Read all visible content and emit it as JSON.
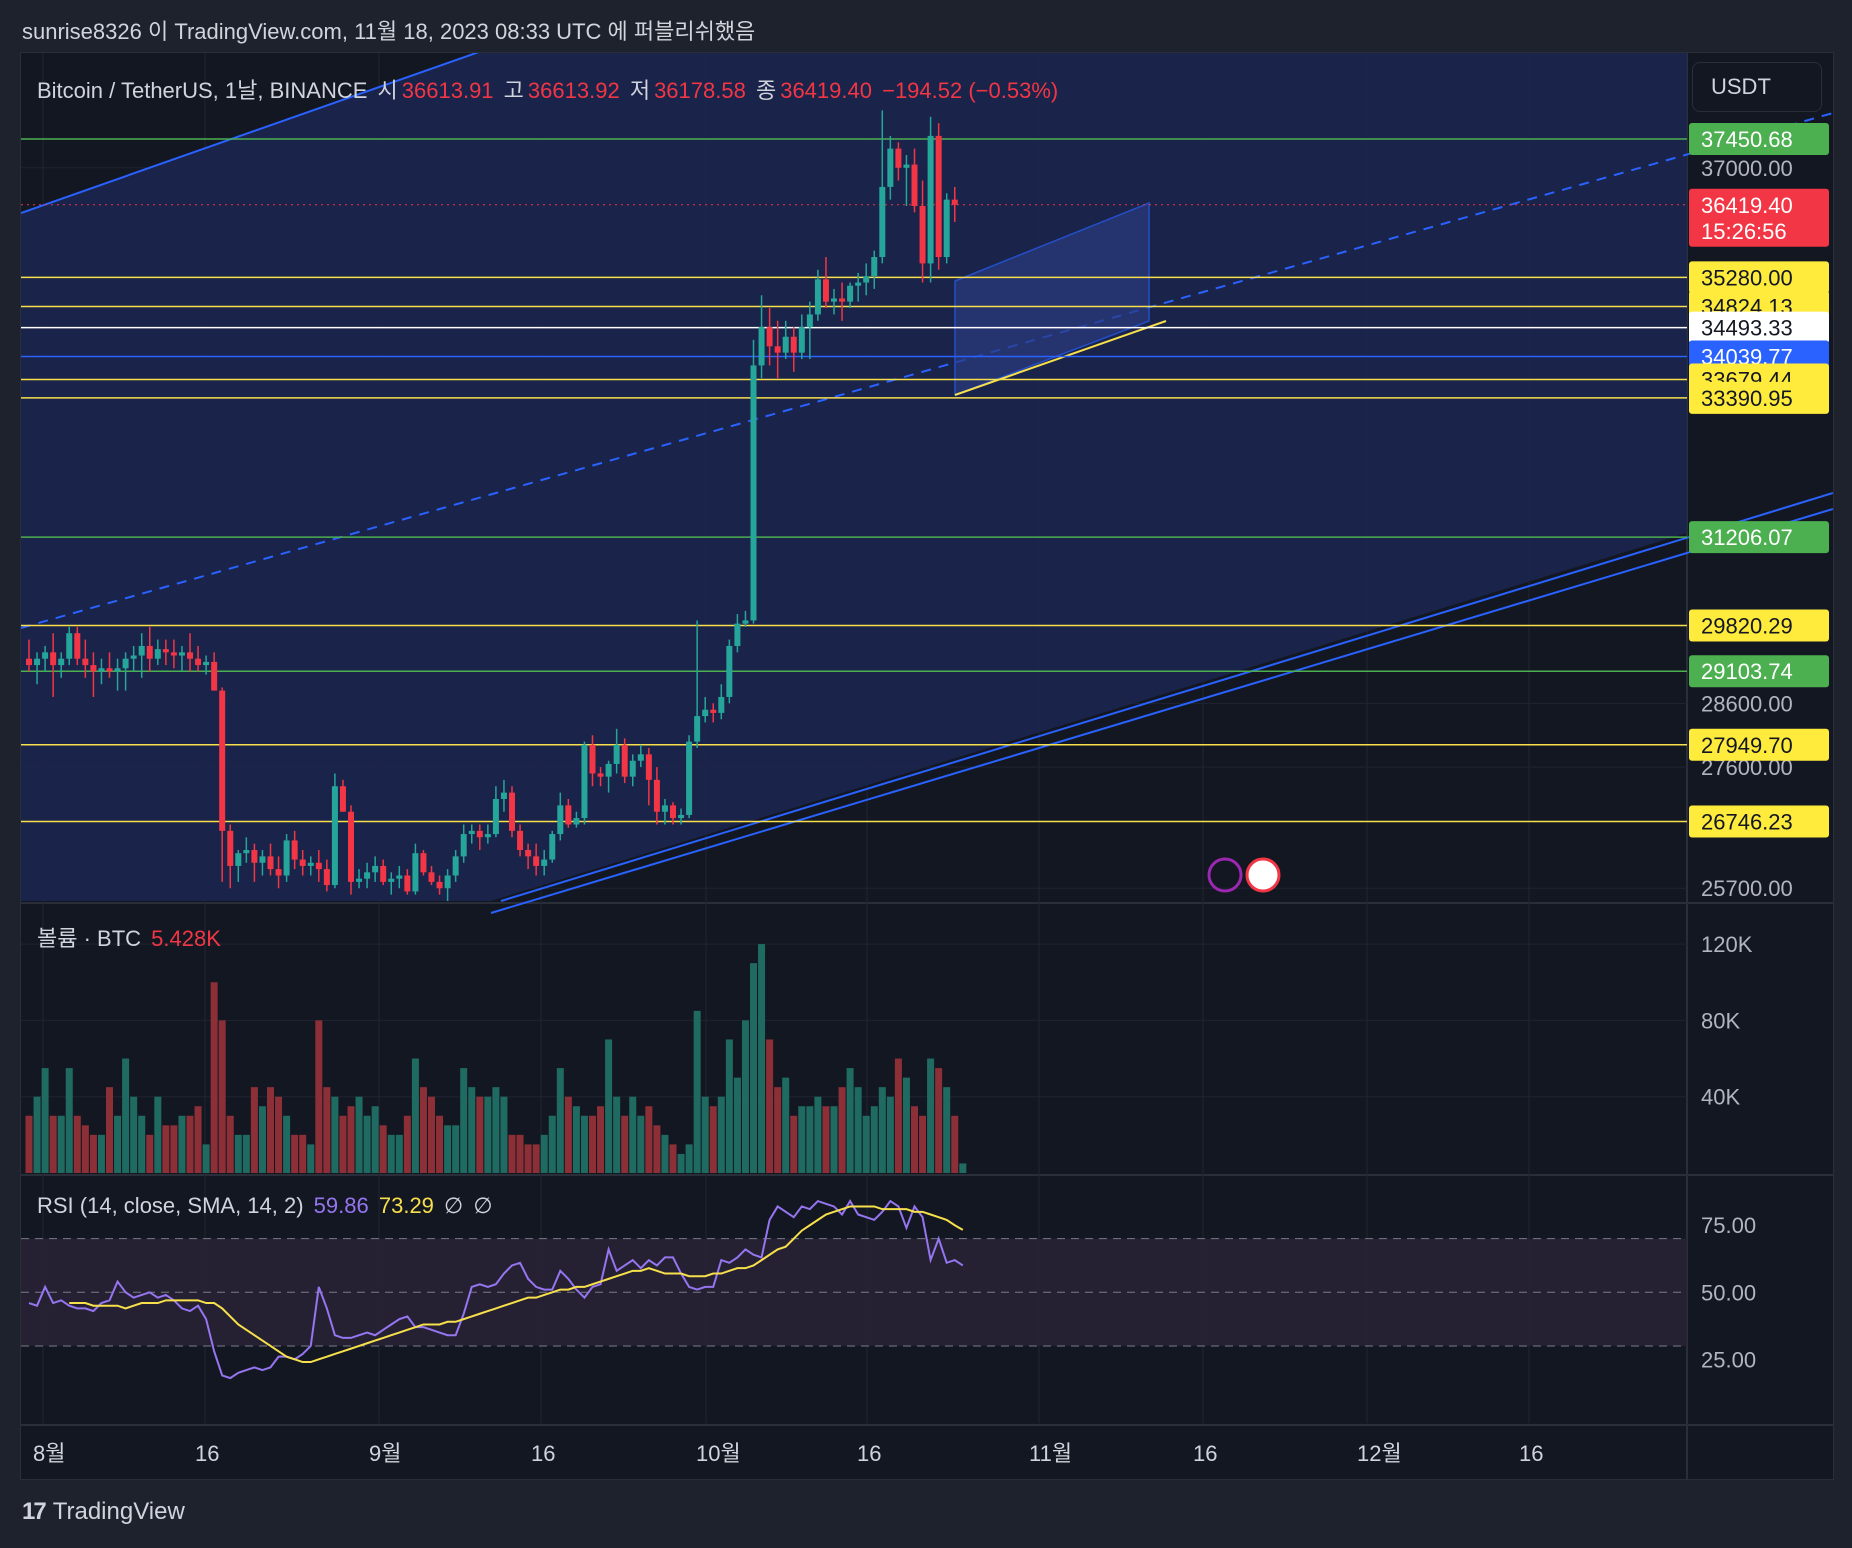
{
  "header": {
    "publisher_line": "sunrise8326 이 TradingView.com, 11월 18, 2023 08:33 UTC 에 퍼블리쉬했음"
  },
  "legend": {
    "symbol": "Bitcoin / TetherUS, 1날, BINANCE",
    "open_label": "시",
    "open_value": "36613.91",
    "high_label": "고",
    "high_value": "36613.92",
    "low_label": "저",
    "low_value": "36178.58",
    "close_label": "종",
    "close_value": "36419.40",
    "change": "−194.52 (−0.53%)"
  },
  "currency": "USDT",
  "volume_legend": {
    "label": "볼륨 · BTC",
    "value": "5.428K"
  },
  "rsi_legend": {
    "label": "RSI (14, close, SMA, 14, 2)",
    "rsi_value": "59.86",
    "sma_value": "73.29",
    "na1": "∅",
    "na2": "∅"
  },
  "footer": {
    "brand": "TradingView",
    "logo": "17"
  },
  "colors": {
    "up": "#26a69a",
    "down": "#f23645",
    "ma_yellow": "#f7e04b",
    "rsi_purple": "#9575f0",
    "green_level": "#4caf50",
    "blue_level": "#2962ff"
  },
  "chart_data": {
    "type": "candlestick",
    "price_axis": {
      "ticks": [
        "37000.00",
        "28600.00",
        "27600.00",
        "25700.00"
      ],
      "ylim": [
        25500,
        38800
      ]
    },
    "time_axis": {
      "labels": [
        "8월",
        "16",
        "9월",
        "16",
        "10월",
        "16",
        "11월",
        "16",
        "12월",
        "16"
      ]
    },
    "price_levels": [
      {
        "value": "37450.68",
        "kind": "green"
      },
      {
        "value": "36419.40",
        "kind": "current",
        "countdown": "15:26:56"
      },
      {
        "value": "35280.00",
        "kind": "yellow"
      },
      {
        "value": "34824.13",
        "kind": "yellow"
      },
      {
        "value": "34493.33",
        "kind": "white"
      },
      {
        "value": "34039.77",
        "kind": "blue"
      },
      {
        "value": "33679.44",
        "kind": "yellow"
      },
      {
        "value": "33390.95",
        "kind": "yellow"
      },
      {
        "value": "31206.07",
        "kind": "green"
      },
      {
        "value": "29820.29",
        "kind": "yellow"
      },
      {
        "value": "29103.74",
        "kind": "green"
      },
      {
        "value": "27949.70",
        "kind": "yellow"
      },
      {
        "value": "26746.23",
        "kind": "yellow"
      }
    ],
    "candles_ohlc": [
      [
        29300,
        29600,
        29100,
        29200
      ],
      [
        29200,
        29400,
        28900,
        29300
      ],
      [
        29300,
        29500,
        29100,
        29400
      ],
      [
        29400,
        29700,
        28700,
        29200
      ],
      [
        29200,
        29400,
        29000,
        29300
      ],
      [
        29300,
        29800,
        29200,
        29700
      ],
      [
        29700,
        29800,
        29200,
        29300
      ],
      [
        29300,
        29600,
        29000,
        29200
      ],
      [
        29200,
        29400,
        28700,
        29100
      ],
      [
        29100,
        29300,
        28900,
        29150
      ],
      [
        29150,
        29400,
        29000,
        29100
      ],
      [
        29100,
        29300,
        28800,
        29150
      ],
      [
        29150,
        29400,
        28800,
        29300
      ],
      [
        29300,
        29500,
        29100,
        29350
      ],
      [
        29350,
        29700,
        29000,
        29500
      ],
      [
        29500,
        29800,
        29100,
        29300
      ],
      [
        29300,
        29600,
        29200,
        29450
      ],
      [
        29450,
        29600,
        29200,
        29400
      ],
      [
        29400,
        29600,
        29150,
        29350
      ],
      [
        29350,
        29500,
        29100,
        29400
      ],
      [
        29400,
        29700,
        29100,
        29300
      ],
      [
        29300,
        29500,
        29100,
        29200
      ],
      [
        29200,
        29350,
        29050,
        29250
      ],
      [
        29250,
        29400,
        28800,
        28800
      ],
      [
        28800,
        28850,
        25800,
        26600
      ],
      [
        26600,
        26700,
        25700,
        26050
      ],
      [
        26050,
        26300,
        25800,
        26250
      ],
      [
        26250,
        26500,
        26100,
        26300
      ],
      [
        26300,
        26400,
        25800,
        26100
      ],
      [
        26100,
        26300,
        25900,
        26200
      ],
      [
        26200,
        26400,
        25900,
        26000
      ],
      [
        26000,
        26200,
        25700,
        25900
      ],
      [
        25900,
        26550,
        25800,
        26450
      ],
      [
        26450,
        26600,
        26000,
        26150
      ],
      [
        26150,
        26300,
        25900,
        26050
      ],
      [
        26050,
        26200,
        25900,
        26100
      ],
      [
        26100,
        26300,
        25800,
        26000
      ],
      [
        26000,
        26150,
        25650,
        25750
      ],
      [
        25750,
        27500,
        25700,
        27300
      ],
      [
        27300,
        27400,
        26900,
        26900
      ],
      [
        26900,
        27000,
        25600,
        25800
      ],
      [
        25800,
        26000,
        25700,
        25850
      ],
      [
        25850,
        26100,
        25700,
        25950
      ],
      [
        25950,
        26200,
        25800,
        26050
      ],
      [
        26050,
        26150,
        25750,
        25800
      ],
      [
        25800,
        25950,
        25600,
        25850
      ],
      [
        25850,
        26050,
        25700,
        25900
      ],
      [
        25900,
        26000,
        25600,
        25650
      ],
      [
        25650,
        26400,
        25600,
        26250
      ],
      [
        26250,
        26300,
        25900,
        25950
      ],
      [
        25950,
        26050,
        25750,
        25800
      ],
      [
        25800,
        25900,
        25600,
        25700
      ],
      [
        25700,
        26000,
        25500,
        25900
      ],
      [
        25900,
        26300,
        25800,
        26200
      ],
      [
        26200,
        26700,
        26100,
        26550
      ],
      [
        26550,
        26700,
        26400,
        26600
      ],
      [
        26600,
        26700,
        26300,
        26500
      ],
      [
        26500,
        26700,
        26400,
        26550
      ],
      [
        26550,
        27300,
        26500,
        27100
      ],
      [
        27100,
        27400,
        26900,
        27200
      ],
      [
        27200,
        27300,
        26500,
        26600
      ],
      [
        26600,
        26700,
        26200,
        26300
      ],
      [
        26300,
        26400,
        26000,
        26200
      ],
      [
        26200,
        26400,
        25900,
        26050
      ],
      [
        26050,
        26300,
        25900,
        26150
      ],
      [
        26150,
        26600,
        26100,
        26550
      ],
      [
        26550,
        27200,
        26450,
        27000
      ],
      [
        27000,
        27100,
        26650,
        26700
      ],
      [
        26700,
        26900,
        26650,
        26800
      ],
      [
        26800,
        28000,
        26700,
        27950
      ],
      [
        27950,
        28100,
        27300,
        27500
      ],
      [
        27500,
        27600,
        27300,
        27450
      ],
      [
        27450,
        27700,
        27200,
        27650
      ],
      [
        27650,
        28200,
        27500,
        27950
      ],
      [
        27950,
        28050,
        27350,
        27450
      ],
      [
        27450,
        27800,
        27300,
        27700
      ],
      [
        27700,
        27950,
        27600,
        27800
      ],
      [
        27800,
        27900,
        27000,
        27400
      ],
      [
        27400,
        27600,
        26700,
        26900
      ],
      [
        26900,
        27100,
        26700,
        27000
      ],
      [
        27000,
        27050,
        26700,
        26800
      ],
      [
        26800,
        26950,
        26700,
        26850
      ],
      [
        26850,
        28100,
        26800,
        28000
      ],
      [
        28000,
        29900,
        27900,
        28400
      ],
      [
        28400,
        28700,
        28300,
        28500
      ],
      [
        28500,
        28600,
        28300,
        28450
      ],
      [
        28450,
        28900,
        28350,
        28700
      ],
      [
        28700,
        29600,
        28600,
        29500
      ],
      [
        29500,
        30000,
        29400,
        29850
      ],
      [
        29850,
        30050,
        29800,
        29900
      ],
      [
        29900,
        34300,
        29850,
        33900
      ],
      [
        33900,
        35000,
        33700,
        34500
      ],
      [
        34500,
        34800,
        33900,
        34200
      ],
      [
        34200,
        34600,
        33700,
        34100
      ],
      [
        34100,
        34600,
        34000,
        34350
      ],
      [
        34350,
        34500,
        33800,
        34100
      ],
      [
        34100,
        34700,
        34000,
        34500
      ],
      [
        34500,
        34900,
        34000,
        34700
      ],
      [
        34700,
        35400,
        34600,
        35250
      ],
      [
        35250,
        35600,
        34800,
        34900
      ],
      [
        34900,
        35100,
        34700,
        34950
      ],
      [
        34950,
        35200,
        34600,
        34900
      ],
      [
        34900,
        35200,
        34800,
        35150
      ],
      [
        35150,
        35350,
        34900,
        35200
      ],
      [
        35200,
        35500,
        35000,
        35300
      ],
      [
        35300,
        35700,
        35100,
        35600
      ],
      [
        35600,
        37900,
        35500,
        36700
      ],
      [
        36700,
        37500,
        36500,
        37300
      ],
      [
        37300,
        37400,
        36800,
        37000
      ],
      [
        37000,
        37200,
        36400,
        37050
      ],
      [
        37050,
        37300,
        36300,
        36400
      ],
      [
        36400,
        36800,
        35200,
        35500
      ],
      [
        35500,
        37800,
        35200,
        37500
      ],
      [
        37500,
        37700,
        35400,
        35600
      ],
      [
        35600,
        36600,
        35500,
        36500
      ],
      [
        36500,
        36700,
        36150,
        36420
      ]
    ],
    "volume_axis": {
      "ticks": [
        "120K",
        "80K",
        "40K"
      ]
    },
    "rsi_axis": {
      "ticks": [
        "75.00",
        "50.00",
        "25.00"
      ],
      "levels": [
        70,
        50,
        30
      ]
    },
    "rsi_values": [
      46,
      45,
      52,
      46,
      47,
      45,
      44,
      44,
      43,
      46,
      47,
      54,
      50,
      48,
      49,
      50,
      48,
      49,
      47,
      44,
      43,
      45,
      40,
      28,
      19,
      18,
      20,
      21,
      22,
      21,
      22,
      26,
      26,
      25,
      27,
      30,
      52,
      44,
      34,
      33,
      33,
      34,
      35,
      34,
      36,
      38,
      40,
      41,
      37,
      37,
      36,
      35,
      34,
      34,
      42,
      52,
      53,
      52,
      53,
      57,
      60,
      61,
      55,
      52,
      51,
      51,
      58,
      55,
      51,
      48,
      52,
      53,
      66,
      58,
      60,
      62,
      59,
      62,
      60,
      63,
      63,
      57,
      52,
      51,
      52,
      52,
      62,
      61,
      63,
      66,
      64,
      63,
      77,
      82,
      80,
      78,
      82,
      81,
      84,
      83,
      82,
      79,
      84,
      79,
      78,
      77,
      80,
      84,
      82,
      74,
      82,
      78,
      62,
      70,
      61,
      62,
      60
    ],
    "rsi_sma_values": [
      46,
      46,
      46,
      45,
      45,
      45,
      45,
      44,
      45,
      46,
      46,
      46,
      47,
      47,
      47,
      47,
      47,
      46,
      46,
      44,
      41,
      38,
      36,
      34,
      32,
      30,
      28,
      26,
      25,
      24,
      24,
      25,
      26,
      27,
      28,
      29,
      30,
      31,
      32,
      33,
      34,
      35,
      36,
      37,
      38,
      38,
      38,
      39,
      39,
      40,
      41,
      42,
      43,
      44,
      45,
      46,
      47,
      48,
      48,
      49,
      50,
      51,
      51,
      52,
      52,
      53,
      54,
      55,
      56,
      57,
      58,
      58,
      59,
      58,
      57,
      57,
      57,
      56,
      56,
      56,
      57,
      57,
      58,
      59,
      59,
      60,
      62,
      64,
      66,
      67,
      70,
      73,
      75,
      77,
      79,
      80,
      81,
      82,
      82,
      82,
      82,
      81,
      81,
      81,
      81,
      80,
      80,
      79,
      78,
      77,
      75,
      73.29
    ],
    "volume_values": [
      30,
      40,
      55,
      30,
      30,
      55,
      30,
      25,
      20,
      20,
      45,
      30,
      60,
      40,
      30,
      20,
      40,
      25,
      25,
      30,
      30,
      35,
      15,
      100,
      80,
      30,
      20,
      20,
      45,
      35,
      45,
      40,
      30,
      20,
      20,
      15,
      80,
      45,
      40,
      30,
      35,
      40,
      30,
      35,
      25,
      20,
      20,
      30,
      60,
      45,
      40,
      30,
      25,
      25,
      55,
      45,
      40,
      40,
      45,
      40,
      20,
      20,
      15,
      15,
      20,
      30,
      55,
      40,
      35,
      30,
      30,
      35,
      70,
      40,
      30,
      40,
      30,
      35,
      25,
      20,
      15,
      10,
      15,
      85,
      40,
      35,
      40,
      70,
      50,
      80,
      110,
      120,
      70,
      45,
      50,
      30,
      35,
      35,
      40,
      35,
      35,
      45,
      55,
      45,
      30,
      35,
      45,
      40,
      60,
      50,
      35,
      30,
      60,
      55,
      45,
      30,
      5
    ]
  }
}
